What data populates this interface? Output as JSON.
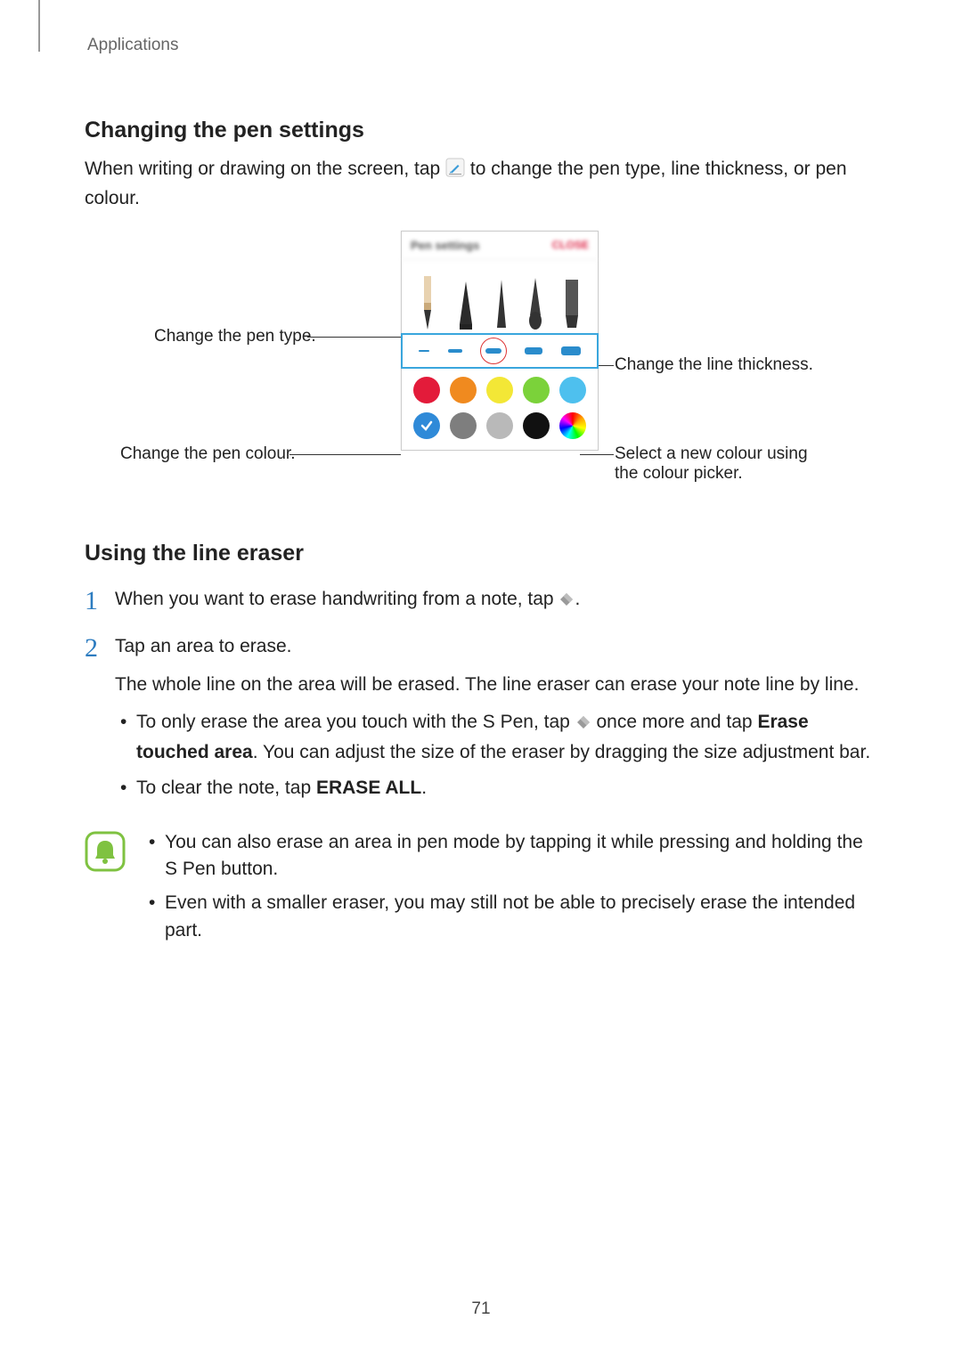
{
  "header": {
    "category": "Applications"
  },
  "section1": {
    "title": "Changing the pen settings",
    "intro_before": "When writing or drawing on the screen, tap ",
    "intro_after": " to change the pen type, line thickness, or pen colour."
  },
  "panel": {
    "title": "Pen settings",
    "close": "CLOSE"
  },
  "callouts": {
    "pen_type": "Change the pen type.",
    "thickness": "Change the line thickness.",
    "colour": "Change the pen colour.",
    "picker": "Select a new colour using the colour picker."
  },
  "section2": {
    "title": "Using the line eraser",
    "steps": [
      {
        "num": "1",
        "text_before": "When you want to erase handwriting from a note, tap ",
        "text_after": "."
      },
      {
        "num": "2",
        "line1": "Tap an area to erase.",
        "line2": "The whole line on the area will be erased. The line eraser can erase your note line by line.",
        "bullets": [
          {
            "pre": "To only erase the area you touch with the S Pen, tap ",
            "mid": " once more and tap ",
            "bold1": "Erase touched area",
            "post": ". You can adjust the size of the eraser by dragging the size adjustment bar."
          },
          {
            "pre": "To clear the note, tap ",
            "bold1": "ERASE ALL",
            "post": "."
          }
        ]
      }
    ],
    "notes": [
      "You can also erase an area in pen mode by tapping it while pressing and holding the S Pen button.",
      "Even with a smaller eraser, you may still not be able to precisely erase the intended part."
    ]
  },
  "colours": {
    "row1": [
      "#e31b3a",
      "#f08a1f",
      "#f3e736",
      "#7bd23a",
      "#4ec0ee"
    ],
    "row2_first": "#2f8ad8",
    "row2": [
      "#7e7e7e",
      "#b9b9b9",
      "#111111"
    ],
    "picker_gradient": "conic"
  },
  "page_number": "71"
}
